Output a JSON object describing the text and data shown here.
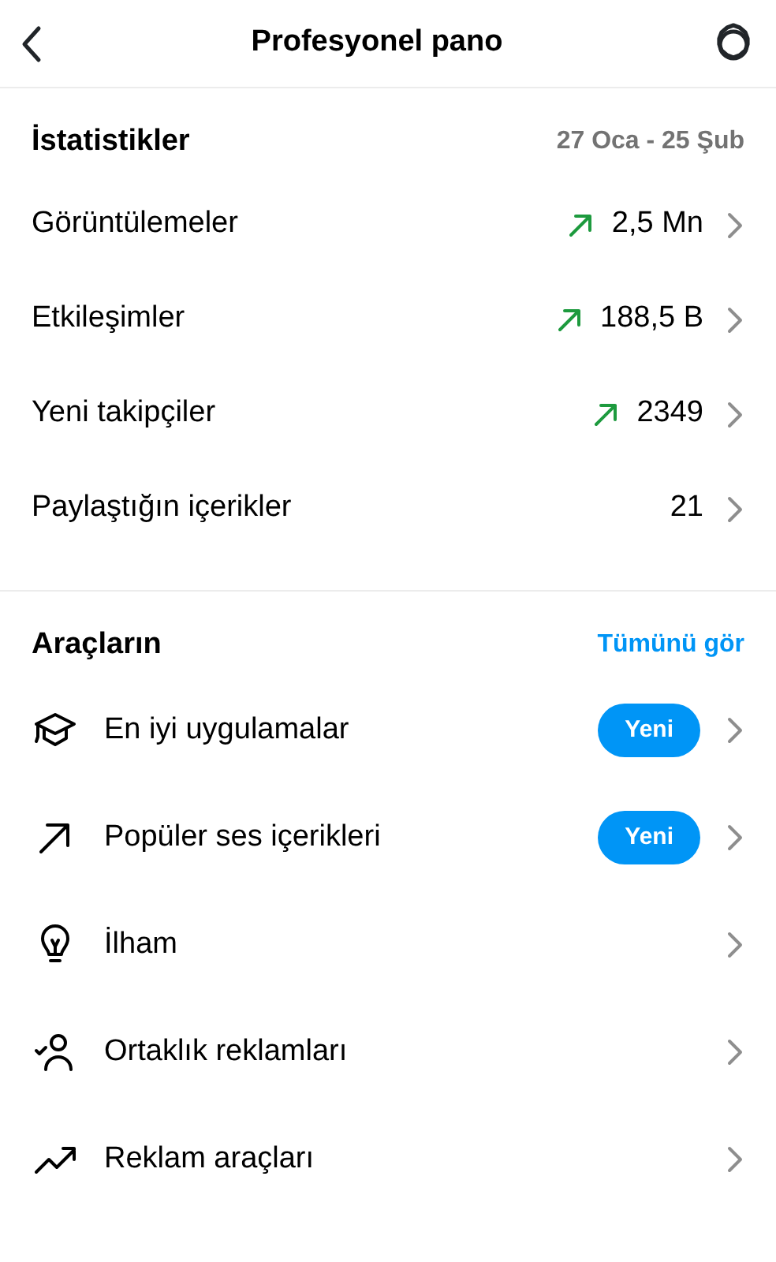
{
  "header": {
    "title": "Profesyonel pano"
  },
  "insights": {
    "title": "İstatistikler",
    "date_range": "27 Oca - 25 Şub",
    "rows": [
      {
        "label": "Görüntülemeler",
        "value": "2,5 Mn",
        "trending": true
      },
      {
        "label": "Etkileşimler",
        "value": "188,5 B",
        "trending": true
      },
      {
        "label": "Yeni takipçiler",
        "value": "2349",
        "trending": true
      },
      {
        "label": "Paylaştığın içerikler",
        "value": "21",
        "trending": false
      }
    ]
  },
  "tools": {
    "title": "Araçların",
    "see_all": "Tümünü gör",
    "items": [
      {
        "kind": "course",
        "label": "En iyi uygulamalar",
        "badge": "Yeni"
      },
      {
        "kind": "arrow",
        "label": "Popüler ses içerikleri",
        "badge": "Yeni"
      },
      {
        "kind": "idea",
        "label": "İlham"
      },
      {
        "kind": "partner",
        "label": "Ortaklık reklamları"
      },
      {
        "kind": "growth",
        "label": "Reklam araçları"
      }
    ]
  }
}
